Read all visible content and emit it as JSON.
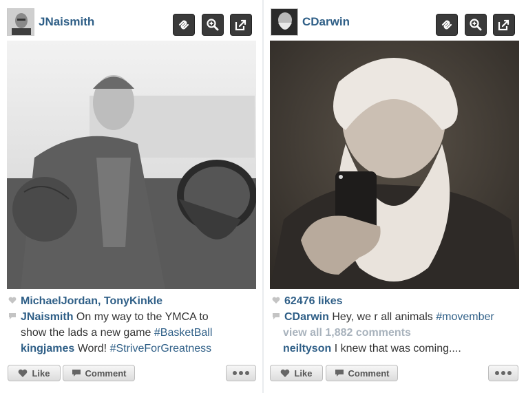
{
  "posts": [
    {
      "username": "JNaismith",
      "likes_line": "MichaelJordan, TonyKinkle",
      "caption": {
        "user": "JNaismith",
        "text_before": "On my way to the YMCA to",
        "text_line2": "show the lads a new game",
        "hashtag": "#BasketBall"
      },
      "comment": {
        "user": "kingjames",
        "text": "Word!",
        "hashtag": "#StriveForGreatness"
      },
      "like_label": "Like",
      "comment_label": "Comment"
    },
    {
      "username": "CDarwin",
      "likes_line": "62476 likes",
      "caption": {
        "user": "CDarwin",
        "text_before": "Hey, we r all animals",
        "hashtag": "#movember"
      },
      "view_all": "view all 1,882 comments",
      "comment": {
        "user": "neiltyson",
        "text": "I knew that was coming...."
      },
      "like_label": "Like",
      "comment_label": "Comment"
    }
  ],
  "icons": {
    "toolbar": [
      "link-icon",
      "zoom-icon",
      "external-link-icon"
    ],
    "footer": [
      "heart-icon",
      "comment-icon",
      "more-icon"
    ]
  },
  "colors": {
    "username": "#2f5f87",
    "muted": "#a9b3bd",
    "toolbar_bg": "#3a3a3a"
  }
}
